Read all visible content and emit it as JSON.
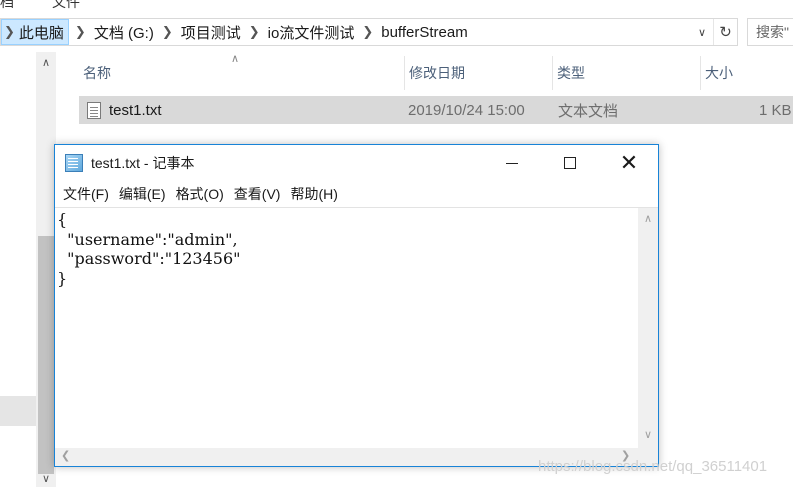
{
  "explorer": {
    "top_fragments": [
      "档",
      "文件"
    ],
    "breadcrumb": [
      "此电脑",
      "文档 (G:)",
      "项目测试",
      "io流文件测试",
      "bufferStream"
    ],
    "search_placeholder": "搜索\"",
    "columns": {
      "name": "名称",
      "modified": "修改日期",
      "type": "类型",
      "size": "大小"
    },
    "files": [
      {
        "name": "test1.txt",
        "modified": "2019/10/24 15:00",
        "type": "文本文档",
        "size": "1 KB"
      }
    ]
  },
  "notepad": {
    "title": "test1.txt - 记事本",
    "menu": [
      "文件(F)",
      "编辑(E)",
      "格式(O)",
      "查看(V)",
      "帮助(H)"
    ],
    "content": "{\n  \"username\":\"admin\",\n  \"password\":\"123456\"\n}",
    "close_glyph": "✕"
  },
  "watermark": "https://blog.csdn.net/qq_36511401"
}
